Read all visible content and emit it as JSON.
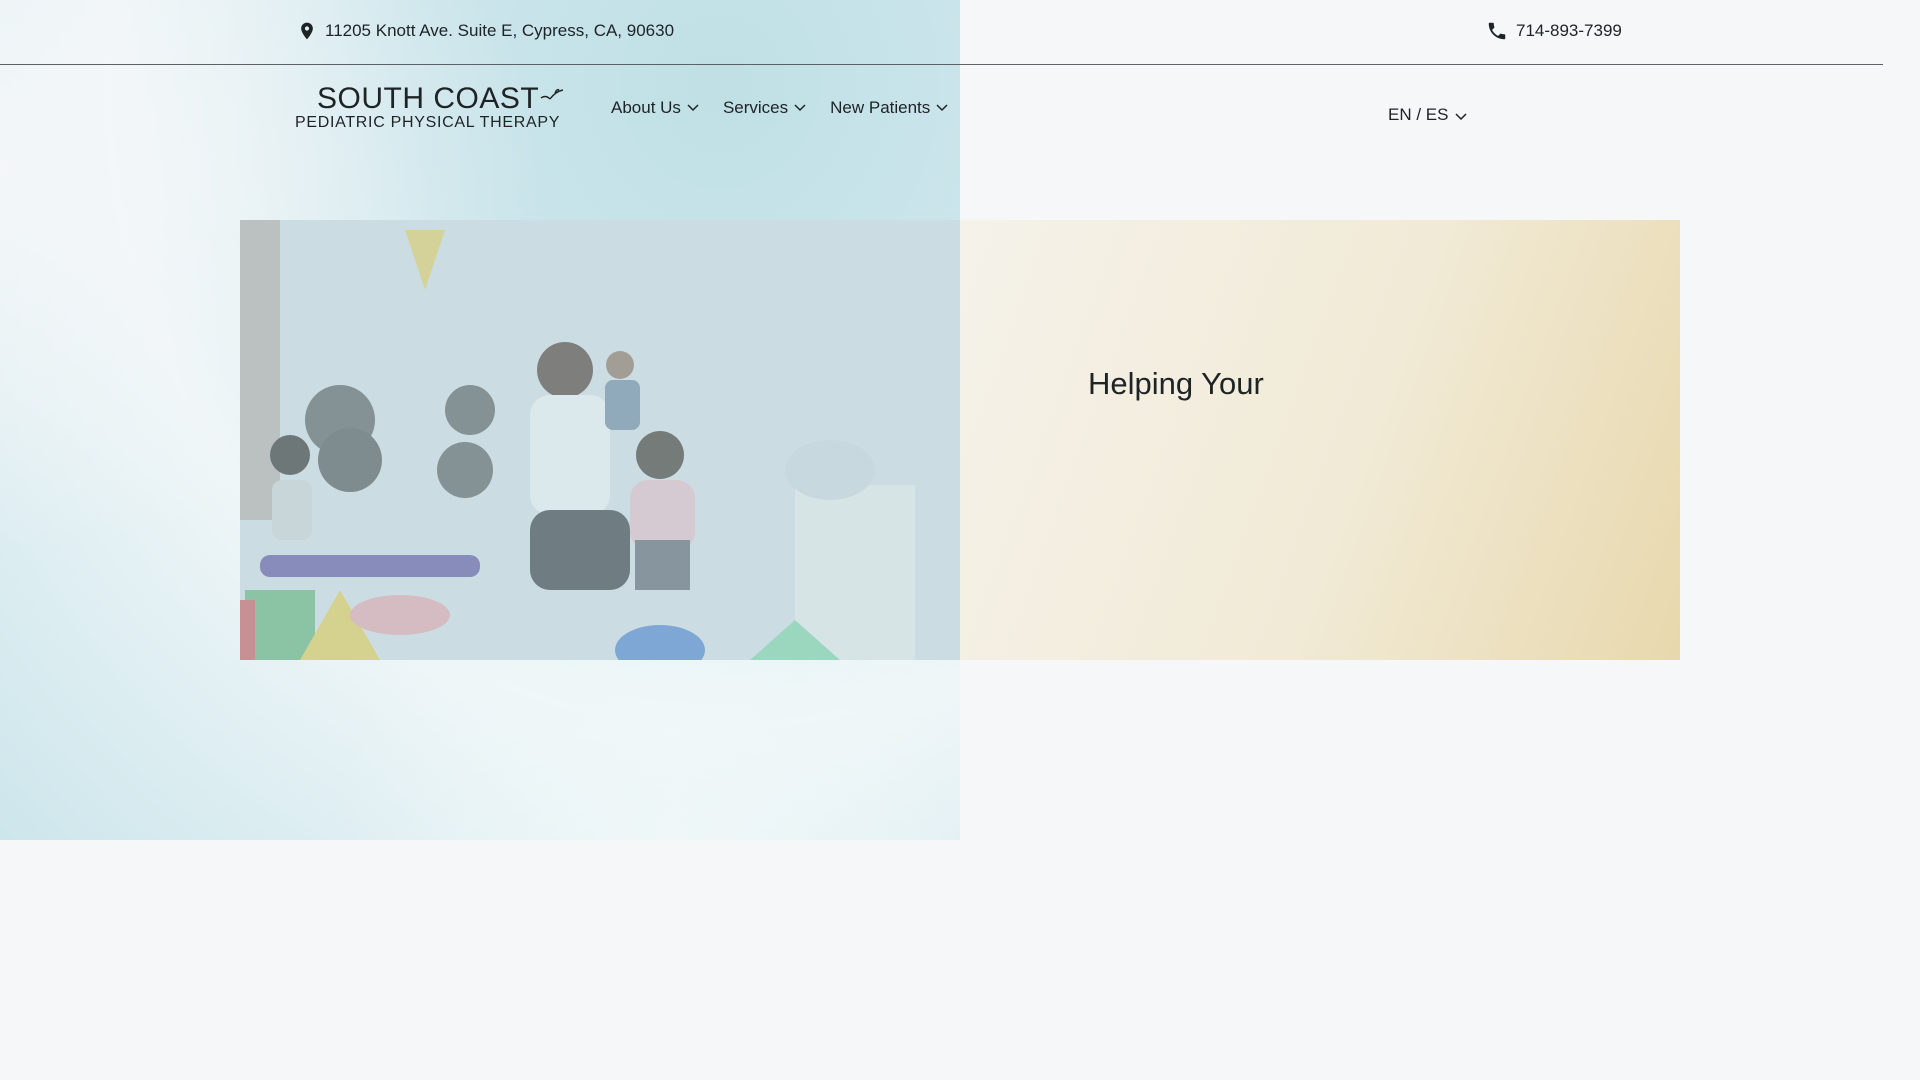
{
  "topbar": {
    "address": "11205 Knott Ave. Suite E, Cypress, CA, 90630",
    "phone": "714-893-7399"
  },
  "logo": {
    "line1": "SOUTH COAST",
    "line2": "PEDIATRIC PHYSICAL THERAPY"
  },
  "nav": {
    "items": [
      {
        "label": "About Us"
      },
      {
        "label": "Services"
      },
      {
        "label": "New Patients"
      }
    ]
  },
  "language": {
    "label": "EN / ES"
  },
  "hero": {
    "heading": "Helping Your"
  },
  "colors": {
    "overlay": "#bfe0e6",
    "panel": "#e8d8ad",
    "background": "#f5f7f9"
  }
}
